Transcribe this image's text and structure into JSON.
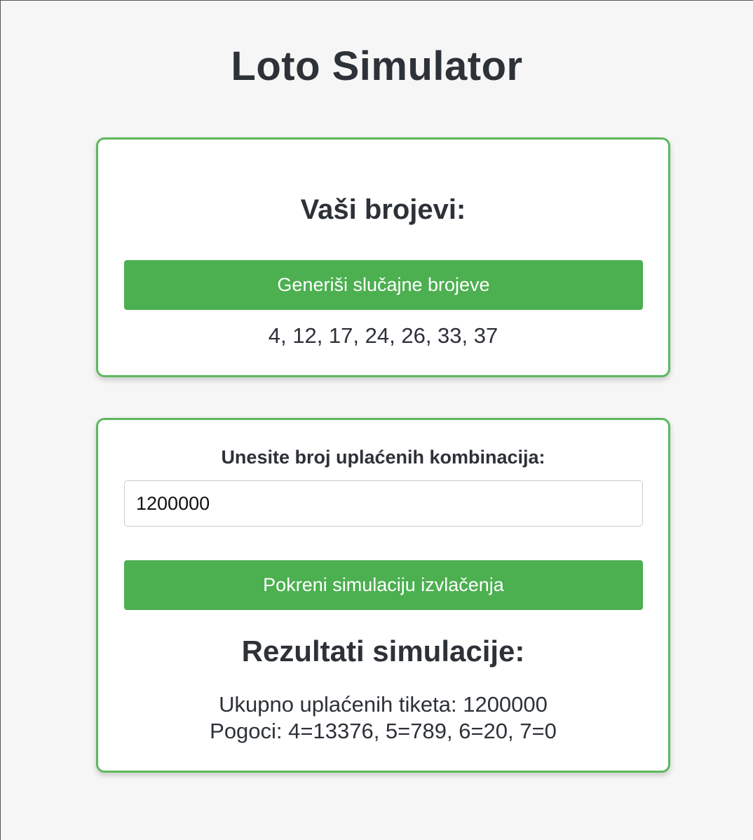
{
  "page": {
    "title": "Loto Simulator"
  },
  "numbers_card": {
    "heading": "Vaši brojevi:",
    "generate_button": "Generiši slučajne brojeve",
    "numbers": "4, 12, 17, 24, 26, 33, 37"
  },
  "simulation_card": {
    "input_label": "Unesite broj uplaćenih kombinacija:",
    "input_value": "1200000",
    "simulate_button": "Pokreni simulaciju izvlačenja",
    "results_heading": "Rezultati simulacije:",
    "total_tickets": "Ukupno uplaćenih tiketa: 1200000",
    "hits": "Pogoci: 4=13376, 5=789, 6=20, 7=0"
  },
  "colors": {
    "accent": "#4caf50",
    "card_border": "#5cb85c",
    "background": "#f6f6f6",
    "text": "#2d3138"
  }
}
